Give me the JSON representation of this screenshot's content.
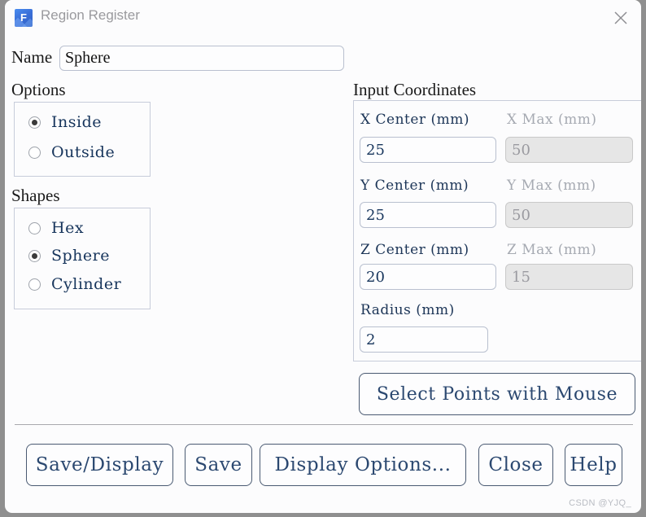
{
  "window": {
    "title": "Region Register",
    "icon": "app-icon-f",
    "icon_letter": "F",
    "close_icon": "close-icon",
    "accent_color": "#3a6fd8",
    "text_color": "#17355c",
    "border_color": "#c7ccda"
  },
  "name_field": {
    "label": "Name",
    "value": "Sphere",
    "placeholder": ""
  },
  "options": {
    "heading": "Options",
    "items": [
      {
        "label": "Inside",
        "checked": true
      },
      {
        "label": "Outside",
        "checked": false
      }
    ]
  },
  "shapes": {
    "heading": "Shapes",
    "items": [
      {
        "label": "Hex",
        "checked": false
      },
      {
        "label": "Sphere",
        "checked": true
      },
      {
        "label": "Cylinder",
        "checked": false
      }
    ]
  },
  "coordinates": {
    "heading": "Input Coordinates",
    "fields": [
      {
        "label": "X Center  (mm)",
        "value": "25",
        "disabled": false
      },
      {
        "label": "X Max  (mm)",
        "value": "50",
        "disabled": true
      },
      {
        "label": "Y Center  (mm)",
        "value": "25",
        "disabled": false
      },
      {
        "label": "Y Max  (mm)",
        "value": "50",
        "disabled": true
      },
      {
        "label": "Z Center  (mm)",
        "value": "20",
        "disabled": false
      },
      {
        "label": "Z Max  (mm)",
        "value": "15",
        "disabled": true
      },
      {
        "label": "Radius  (mm)",
        "value": "2",
        "disabled": false
      }
    ],
    "select_points_label": "Select Points with Mouse"
  },
  "bottom_buttons": [
    {
      "label": "Save/Display"
    },
    {
      "label": "Save"
    },
    {
      "label": "Display Options..."
    },
    {
      "label": "Close"
    },
    {
      "label": "Help"
    }
  ],
  "watermark": "CSDN @YJQ_"
}
